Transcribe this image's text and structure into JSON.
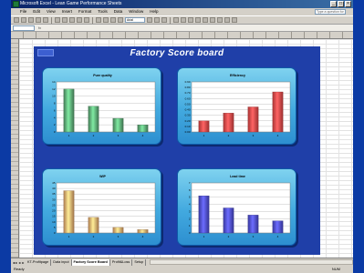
{
  "window": {
    "title": "Microsoft Excel - Lean Game Performance Sheets",
    "menu": [
      "File",
      "Edit",
      "View",
      "Insert",
      "Format",
      "Tools",
      "Data",
      "Window",
      "Help"
    ],
    "help_placeholder": "Type a question for help",
    "font_name": "Arial"
  },
  "board": {
    "title": "Factory Score board"
  },
  "sheet_tabs": [
    "KT-Profitpage",
    "Data input",
    "Factory Score Board",
    "Profit&Loss",
    "Setup"
  ],
  "active_tab_index": 2,
  "status": {
    "left": "Ready",
    "right": "NUM"
  },
  "colors": {
    "green": "#5fae79",
    "red": "#f04a4a",
    "orange": "#f5b070",
    "blue": "#5050e0",
    "board": "#1f3fa8"
  },
  "chart_data": [
    {
      "type": "bar",
      "title": "Pure quality",
      "categories": [
        "1",
        "2",
        "3",
        "4"
      ],
      "values": [
        12,
        7.2,
        3.8,
        2
      ],
      "yticks": [
        "0",
        "2",
        "4",
        "6",
        "8",
        "10",
        "12",
        "14"
      ],
      "ylim": [
        0,
        14
      ],
      "color": "green",
      "grid": true
    },
    {
      "type": "bar",
      "title": "Efficiency",
      "categories": [
        "1",
        "2",
        "3",
        "4"
      ],
      "values": [
        0.2,
        0.34,
        0.45,
        0.72
      ],
      "yticks": [
        "0.00",
        "0.10",
        "0.20",
        "0.30",
        "0.40",
        "0.50",
        "0.60",
        "0.70",
        "0.80",
        "0.90"
      ],
      "ylim": [
        0,
        0.9
      ],
      "color": "red",
      "grid": true
    },
    {
      "type": "bar",
      "title": "WIP",
      "categories": [
        "1",
        "2",
        "3",
        "4"
      ],
      "values": [
        38,
        14,
        5,
        3
      ],
      "yticks": [
        "0",
        "5",
        "10",
        "15",
        "20",
        "25",
        "30",
        "35",
        "40",
        "45"
      ],
      "ylim": [
        0,
        45
      ],
      "color": "orange",
      "grid": true
    },
    {
      "type": "bar",
      "title": "Lead time",
      "categories": [
        "1",
        "2",
        "3",
        "4"
      ],
      "values": [
        5.2,
        3.5,
        2.5,
        1.7
      ],
      "yticks": [
        "0",
        "1",
        "2",
        "3",
        "4",
        "5",
        "6",
        "7"
      ],
      "ylim": [
        0,
        7
      ],
      "color": "blue",
      "grid": true
    }
  ]
}
